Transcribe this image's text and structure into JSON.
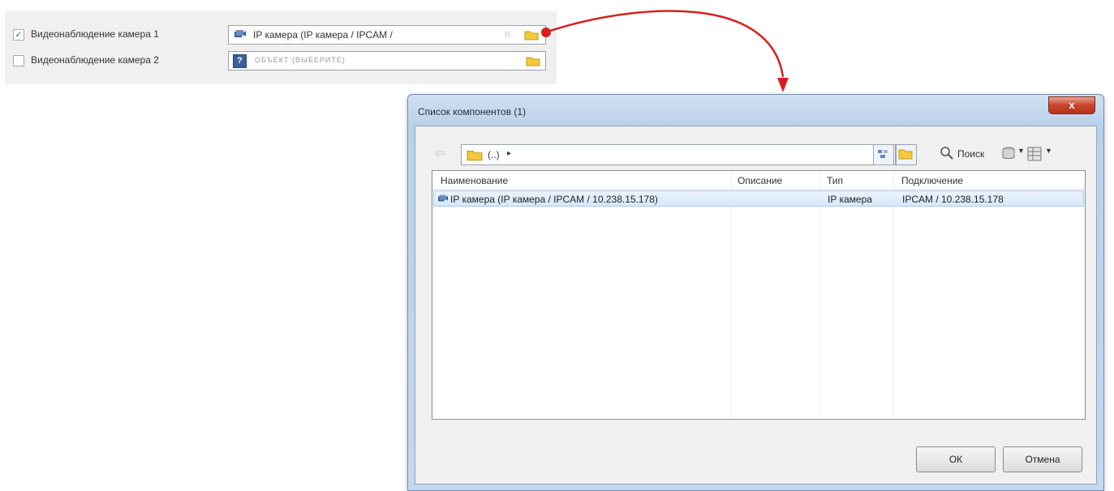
{
  "settings": {
    "rows": [
      {
        "checked": true,
        "label": "Видеонаблюдение камера 1",
        "value": "IP камера (IP камера / IPCAM /",
        "placeholder": ""
      },
      {
        "checked": false,
        "label": "Видеонаблюдение камера 2",
        "value": "",
        "placeholder": "ОБЪЕКТ (ВЫБЕРИТЕ)"
      }
    ]
  },
  "dialog": {
    "title": "Список компонентов (1)",
    "close_label": "x",
    "path_text": "(..)",
    "search_label": "Поиск",
    "columns": [
      "Наименование",
      "Описание",
      "Тип",
      "Подключение"
    ],
    "rows": [
      {
        "name": "IP камера (IP камера / IPCAM / 10.238.15.178)",
        "description": "",
        "type": "IP камера",
        "connection": "IPCAM / 10.238.15.178"
      }
    ],
    "ok_label": "ОК",
    "cancel_label": "Отмена"
  },
  "colors": {
    "arrow": "#d62020",
    "selection": "#d6e8fb",
    "close": "#c7442c"
  },
  "icons": [
    "camera-icon",
    "folder-icon",
    "question-icon",
    "back-arrow-icon",
    "search-icon",
    "database-icon",
    "grid-view-icon"
  ]
}
